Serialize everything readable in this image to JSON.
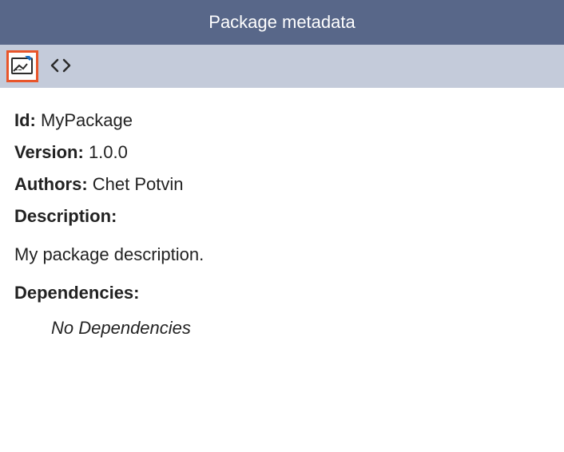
{
  "titlebar": {
    "text": "Package metadata"
  },
  "toolbar": {
    "form_view_selected": true
  },
  "metadata": {
    "id_label": "Id:",
    "id_value": "MyPackage",
    "version_label": "Version:",
    "version_value": "1.0.0",
    "authors_label": "Authors:",
    "authors_value": "Chet Potvin",
    "description_label": "Description:",
    "description_value": "My package description.",
    "dependencies_label": "Dependencies:",
    "dependencies_none": "No Dependencies"
  }
}
